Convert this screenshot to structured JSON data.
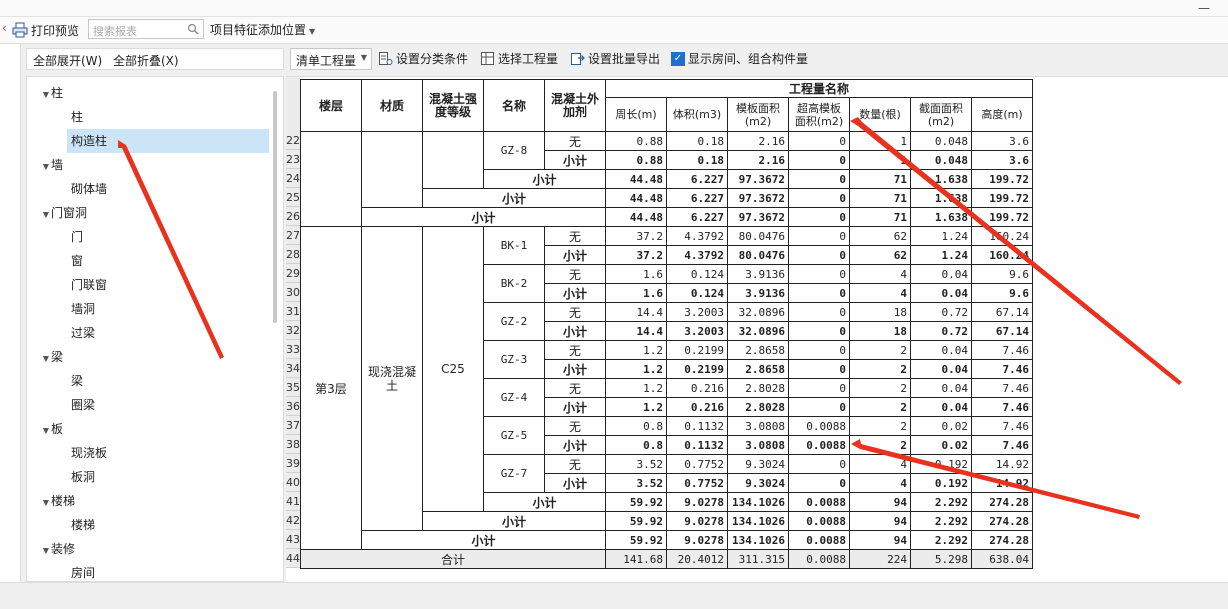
{
  "topbar": {
    "minimize": "—"
  },
  "toolbar": {
    "print_preview": "打印预览",
    "search_placeholder": "搜索报表",
    "feature_location": "项目特征添加位置"
  },
  "left_panel": {
    "expand_all": "全部展开(W)",
    "collapse_all": "全部折叠(X)",
    "tree": [
      {
        "type": "cat",
        "label": "柱"
      },
      {
        "type": "leaf",
        "label": "柱"
      },
      {
        "type": "leaf",
        "label": "构造柱",
        "selected": true
      },
      {
        "type": "cat",
        "label": "墙"
      },
      {
        "type": "leaf",
        "label": "砌体墙"
      },
      {
        "type": "cat",
        "label": "门窗洞"
      },
      {
        "type": "leaf",
        "label": "门"
      },
      {
        "type": "leaf",
        "label": "窗"
      },
      {
        "type": "leaf",
        "label": "门联窗"
      },
      {
        "type": "leaf",
        "label": "墙洞"
      },
      {
        "type": "leaf",
        "label": "过梁"
      },
      {
        "type": "cat",
        "label": "梁"
      },
      {
        "type": "leaf",
        "label": "梁"
      },
      {
        "type": "leaf",
        "label": "圈梁"
      },
      {
        "type": "cat",
        "label": "板"
      },
      {
        "type": "leaf",
        "label": "现浇板"
      },
      {
        "type": "leaf",
        "label": "板洞"
      },
      {
        "type": "cat",
        "label": "楼梯"
      },
      {
        "type": "leaf",
        "label": "楼梯"
      },
      {
        "type": "cat",
        "label": "装修"
      },
      {
        "type": "leaf",
        "label": "房间"
      }
    ]
  },
  "right_toolbar": {
    "dropdown_value": "清单工程量",
    "set_category": "设置分类条件",
    "select_quantity": "选择工程量",
    "batch_export": "设置批量导出",
    "show_room": "显示房间、组合构件量",
    "show_room_checked": true
  },
  "table": {
    "headers": {
      "floor": "楼层",
      "material": "材质",
      "grade": "混凝土强度等级",
      "name": "名称",
      "additive": "混凝土外加剂",
      "group": "工程量名称",
      "perimeter": "周长(m)",
      "volume": "体积(m3)",
      "formwork": "模板面积(m2)",
      "over_height": "超高模板面积(m2)",
      "count": "数量(根)",
      "section": "截面面积(m2)",
      "height": "高度(m)"
    },
    "row_numbers": [
      "22",
      "23",
      "24",
      "25",
      "26",
      "27",
      "28",
      "29",
      "30",
      "31",
      "32",
      "33",
      "34",
      "35",
      "36",
      "37",
      "38",
      "39",
      "40",
      "41",
      "42",
      "43",
      "44"
    ],
    "floor_value": "第3层",
    "material_value": "现浇混凝土",
    "grade_value": "C25",
    "wu": "无",
    "subtotal": "小计",
    "total": "合计",
    "names": [
      "GZ-8",
      "BK-1",
      "BK-2",
      "GZ-2",
      "GZ-3",
      "GZ-4",
      "GZ-5",
      "GZ-7"
    ],
    "values": [
      [
        "0.88",
        "0.18",
        "2.16",
        "0",
        "1",
        "0.048",
        "3.6"
      ],
      [
        "0.88",
        "0.18",
        "2.16",
        "0",
        "1",
        "0.048",
        "3.6"
      ],
      [
        "44.48",
        "6.227",
        "97.3672",
        "0",
        "71",
        "1.638",
        "199.72"
      ],
      [
        "44.48",
        "6.227",
        "97.3672",
        "0",
        "71",
        "1.638",
        "199.72"
      ],
      [
        "44.48",
        "6.227",
        "97.3672",
        "0",
        "71",
        "1.638",
        "199.72"
      ],
      [
        "37.2",
        "4.3792",
        "80.0476",
        "0",
        "62",
        "1.24",
        "160.24"
      ],
      [
        "37.2",
        "4.3792",
        "80.0476",
        "0",
        "62",
        "1.24",
        "160.24"
      ],
      [
        "1.6",
        "0.124",
        "3.9136",
        "0",
        "4",
        "0.04",
        "9.6"
      ],
      [
        "1.6",
        "0.124",
        "3.9136",
        "0",
        "4",
        "0.04",
        "9.6"
      ],
      [
        "14.4",
        "3.2003",
        "32.0896",
        "0",
        "18",
        "0.72",
        "67.14"
      ],
      [
        "14.4",
        "3.2003",
        "32.0896",
        "0",
        "18",
        "0.72",
        "67.14"
      ],
      [
        "1.2",
        "0.2199",
        "2.8658",
        "0",
        "2",
        "0.04",
        "7.46"
      ],
      [
        "1.2",
        "0.2199",
        "2.8658",
        "0",
        "2",
        "0.04",
        "7.46"
      ],
      [
        "1.2",
        "0.216",
        "2.8028",
        "0",
        "2",
        "0.04",
        "7.46"
      ],
      [
        "1.2",
        "0.216",
        "2.8028",
        "0",
        "2",
        "0.04",
        "7.46"
      ],
      [
        "0.8",
        "0.1132",
        "3.0808",
        "0.0088",
        "2",
        "0.02",
        "7.46"
      ],
      [
        "0.8",
        "0.1132",
        "3.0808",
        "0.0088",
        "2",
        "0.02",
        "7.46"
      ],
      [
        "3.52",
        "0.7752",
        "9.3024",
        "0",
        "4",
        "0.192",
        "14.92"
      ],
      [
        "3.52",
        "0.7752",
        "9.3024",
        "0",
        "4",
        "0.192",
        "14.92"
      ],
      [
        "59.92",
        "9.0278",
        "134.1026",
        "0.0088",
        "94",
        "2.292",
        "274.28"
      ],
      [
        "59.92",
        "9.0278",
        "134.1026",
        "0.0088",
        "94",
        "2.292",
        "274.28"
      ],
      [
        "59.92",
        "9.0278",
        "134.1026",
        "0.0088",
        "94",
        "2.292",
        "274.28"
      ],
      [
        "141.68",
        "20.4012",
        "311.315",
        "0.0088",
        "224",
        "5.298",
        "638.04"
      ]
    ]
  },
  "colors": {
    "selection": "#cce4f7",
    "annotation_arrow": "#e8321e",
    "checkbox": "#1e6fd0"
  }
}
